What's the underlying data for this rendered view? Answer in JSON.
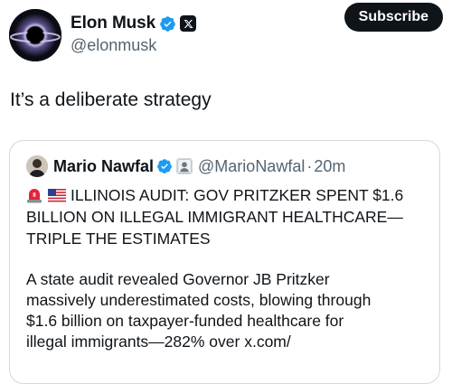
{
  "author": {
    "display_name": "Elon Musk",
    "handle": "@elonmusk",
    "verified_icon": "verified-badge-icon",
    "affiliate_icon": "x-logo-icon"
  },
  "subscribe_label": "Subscribe",
  "tweet_text": "It’s a deliberate strategy",
  "quote": {
    "display_name": "Mario Nawfal",
    "handle": "@MarioNawfal",
    "separator": "·",
    "time": "20m",
    "headline_icons": [
      "siren-icon",
      "us-flag-icon"
    ],
    "headline_line1": "ILLINOIS AUDIT: GOV PRITZKER SPENT $1.6",
    "headline_line2": "BILLION ON ILLEGAL IMMIGRANT HEALTHCARE—",
    "headline_line3": "TRIPLE THE ESTIMATES",
    "body_line1": "A state audit revealed Governor JB Pritzker",
    "body_line2": "massively underestimated costs, blowing through",
    "body_line3": "$1.6 billion on taxpayer-funded healthcare for",
    "body_line4": "illegal immigrants—282% over x.com/"
  },
  "colors": {
    "text": "#0f1419",
    "secondary": "#536471",
    "verified_blue": "#1d9bf0",
    "border": "#cfd9de",
    "button": "#0f1419"
  }
}
